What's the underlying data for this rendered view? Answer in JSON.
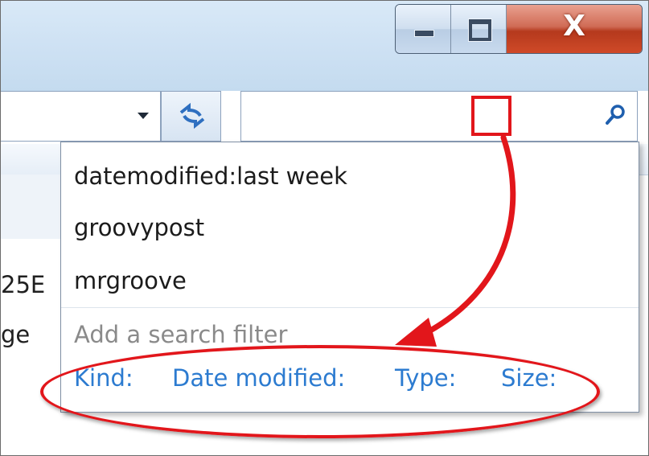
{
  "window": {
    "minimize_icon": "minimize-icon",
    "maximize_icon": "maximize-icon",
    "close_glyph": "X"
  },
  "address_bar": {
    "dropdown_icon": "chevron-down-icon",
    "refresh_icon": "refresh-icon"
  },
  "search": {
    "value": "",
    "icon": "search-icon"
  },
  "background_pane": {
    "line1": "25E",
    "line2": "ge"
  },
  "dropdown": {
    "suggestions": [
      "datemodified:last week",
      "groovypost",
      "mrgroove"
    ],
    "add_filter_label": "Add a search filter",
    "filters": [
      "Kind:",
      "Date modified:",
      "Type:",
      "Size:"
    ]
  },
  "colors": {
    "accent": "#2c7bd0",
    "annotation": "#e2161b"
  }
}
